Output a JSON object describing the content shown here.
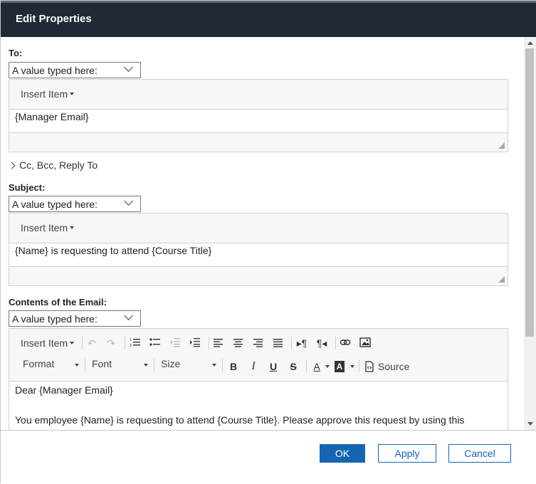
{
  "dialog": {
    "title": "Edit Properties"
  },
  "to": {
    "label": "To:",
    "select_value": "A value typed here:",
    "insert_item": "Insert Item",
    "content": "{Manager Email}"
  },
  "cc": {
    "label": "Cc, Bcc, Reply To"
  },
  "subject": {
    "label": "Subject:",
    "select_value": "A value typed here:",
    "insert_item": "Insert Item",
    "content": "{Name} is requesting to attend {Course Title}"
  },
  "contents": {
    "label": "Contents of the Email:",
    "select_value": "A value typed here:",
    "toolbar": {
      "insert_item": "Insert Item",
      "format": "Format",
      "font": "Font",
      "size": "Size",
      "bold": "B",
      "italic": "I",
      "underline": "U",
      "strike": "S",
      "text_color": "A",
      "bg_color": "A",
      "source": "Source"
    },
    "lines": [
      "Dear {Manager Email}",
      "You employee {Name} is requesting to attend {Course Title}. Please approve this request by using this"
    ]
  },
  "buttons": {
    "ok": "OK",
    "apply": "Apply",
    "cancel": "Cancel"
  }
}
